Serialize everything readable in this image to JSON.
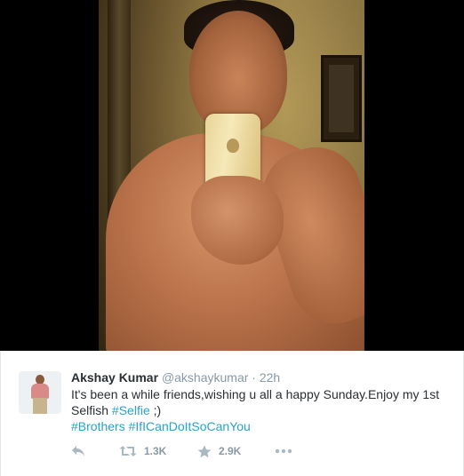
{
  "tweet": {
    "author_name": "Akshay Kumar",
    "handle": "@akshaykumar",
    "separator": "·",
    "time": "22h",
    "text_line1": "It's been a while friends,wishing u all a happy Sunday.Enjoy my 1st",
    "text_line2_prefix": "Selfish ",
    "hashtag_selfie": "#Selfie",
    "text_line2_suffix": " ;)",
    "hashtag_brothers": "#Brothers",
    "hashtag_ificandoit": "#IfICanDoItSoCanYou",
    "hashtag_space": " "
  },
  "actions": {
    "reply_icon": "reply-icon",
    "retweet_icon": "retweet-icon",
    "retweet_count": "1.3K",
    "favorite_icon": "star-icon",
    "favorite_count": "2.9K",
    "more_icon": "more-icon"
  },
  "colors": {
    "hashtag": "#2aa3c8",
    "name": "#292f33",
    "muted": "#8899a6",
    "icon": "#aab8c2"
  }
}
